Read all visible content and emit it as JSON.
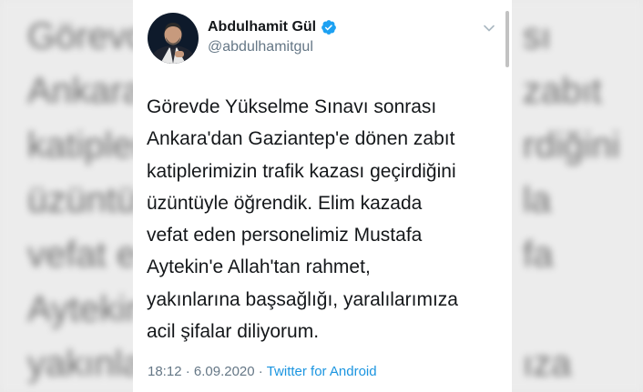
{
  "background": {
    "lines": [
      "Görevde",
      "Ankara'",
      "katipler",
      "üzüntüy",
      "vefat e",
      "Aytekin",
      "yakınla"
    ],
    "right_lines": [
      "sı",
      "zabıt",
      "rdiğini",
      "la",
      "fa",
      "",
      "ıza"
    ]
  },
  "tweet": {
    "author_name": "Abdulhamit Gül",
    "author_handle": "@abdulhamitgul",
    "verified_color": "#1da1f2",
    "lines": [
      "Görevde Yükselme Sınavı sonrası",
      "Ankara'dan Gaziantep'e dönen zabıt",
      "katiplerimizin trafik kazası geçirdiğini",
      "üzüntüyle öğrendik. Elim kazada",
      "vefat eden personelimiz Mustafa",
      "Aytekin'e Allah'tan rahmet,",
      "yakınlarına başsağlığı, yaralılarımıza",
      "acil şifalar diliyorum."
    ],
    "time": "18:12",
    "separator": "·",
    "date": "6.09.2020",
    "source": "Twitter for Android"
  }
}
